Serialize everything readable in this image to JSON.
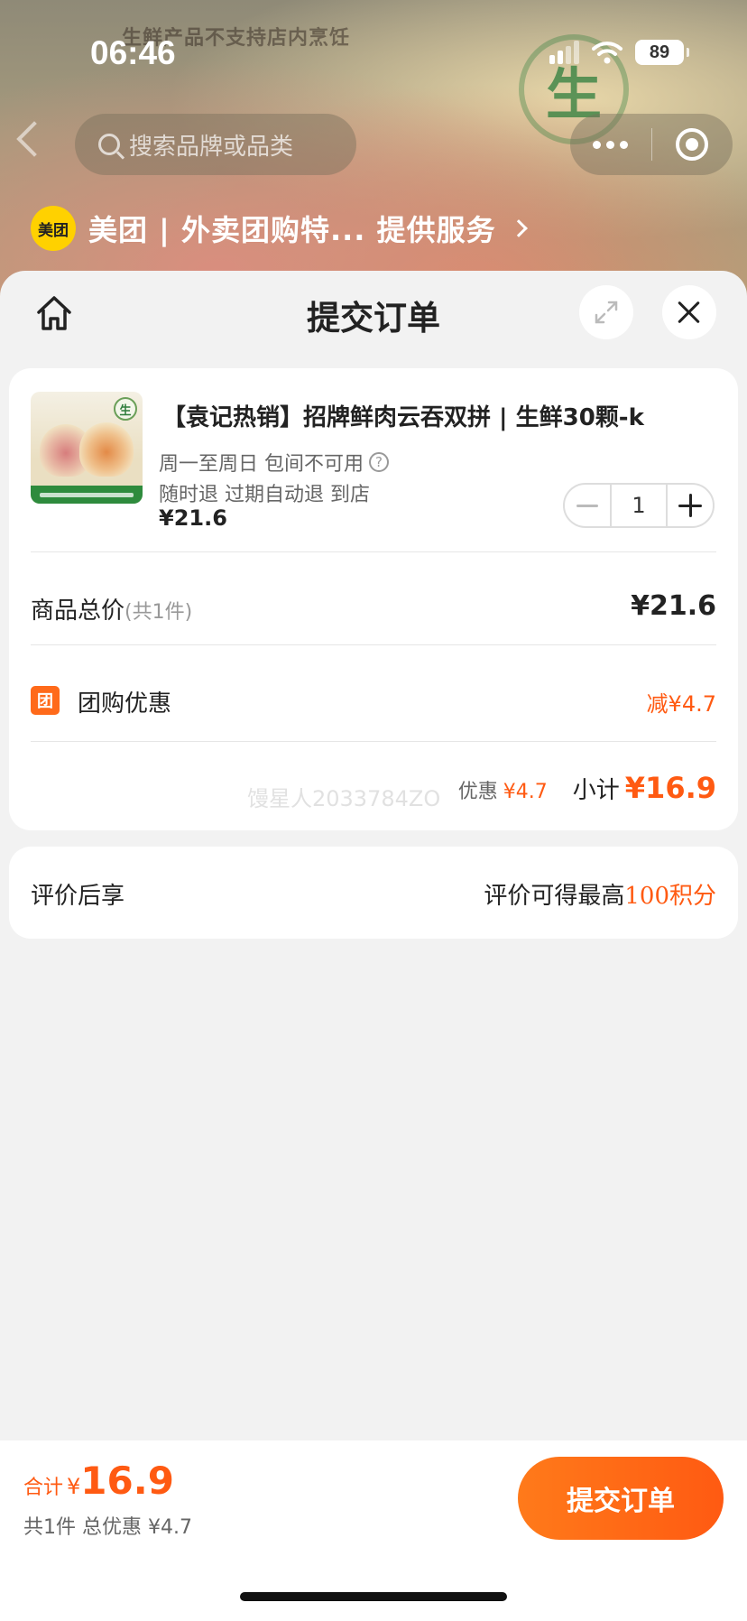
{
  "status_bar": {
    "time": "06:46",
    "battery": "89"
  },
  "hero": {
    "banner_text": "生鲜产品不支持店内烹饪",
    "seal_text": "生"
  },
  "nav": {
    "search_placeholder": "搜索品牌或品类"
  },
  "provider": {
    "logo_text": "美团",
    "text": "美团 | 外卖团购特...  提供服务"
  },
  "sheet": {
    "title": "提交订单"
  },
  "product": {
    "title": "【袁记热销】招牌鲜肉云吞双拼 | 生鲜30颗-k",
    "availability": "周一至周日 包间不可用",
    "policy": "随时退 过期自动退 到店",
    "price": "¥21.6",
    "quantity": "1",
    "image_seal": "生"
  },
  "summary": {
    "total_label": "商品总价",
    "total_count": "(共1件)",
    "total_value": "¥21.6",
    "discount_badge": "团",
    "discount_label": "团购优惠",
    "discount_value": "减¥4.7",
    "watermark": "馒星人2033784ZO",
    "sub_discount_label": "优惠",
    "sub_discount_value": "¥4.7",
    "subtotal_label": "小计",
    "subtotal_value": "¥16.9"
  },
  "review": {
    "label": "评价后享",
    "right_text": "评价可得最高",
    "points": "100积分"
  },
  "bottom_bar": {
    "sum_label": "合计",
    "sum_currency": "¥",
    "sum_value": "16.9",
    "sum_sub": "共1件 总优惠 ¥4.7",
    "submit_label": "提交订单"
  },
  "colors": {
    "accent": "#ff5a12",
    "brand_yellow": "#ffd100"
  }
}
